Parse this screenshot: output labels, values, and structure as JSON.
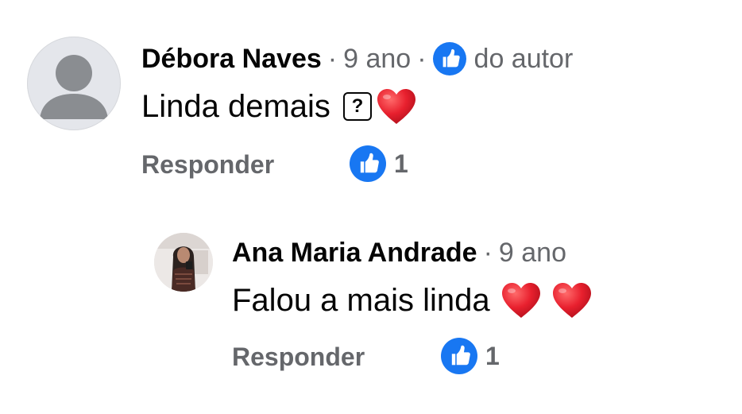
{
  "colors": {
    "like_blue": "#1877f2",
    "secondary_text": "#65676b",
    "primary_text": "#050505",
    "heart_red": "#e8202e"
  },
  "comments": [
    {
      "author": "Débora Naves",
      "separator": "·",
      "time": "9 ano",
      "author_badge_icon": "thumbs-up-icon",
      "author_badge_text": "do autor",
      "avatar": "default-avatar",
      "text": "Linda demais",
      "unsupported_glyph": "?",
      "emojis": [
        "red-heart"
      ],
      "reply_label": "Responder",
      "reaction_icon": "thumbs-up-icon",
      "reaction_count": "1"
    },
    {
      "author": "Ana Maria Andrade",
      "separator": "·",
      "time": "9 ano",
      "avatar": "user-photo",
      "text": "Falou a mais linda",
      "emojis": [
        "red-heart",
        "red-heart"
      ],
      "reply_label": "Responder",
      "reaction_icon": "thumbs-up-icon",
      "reaction_count": "1"
    }
  ]
}
